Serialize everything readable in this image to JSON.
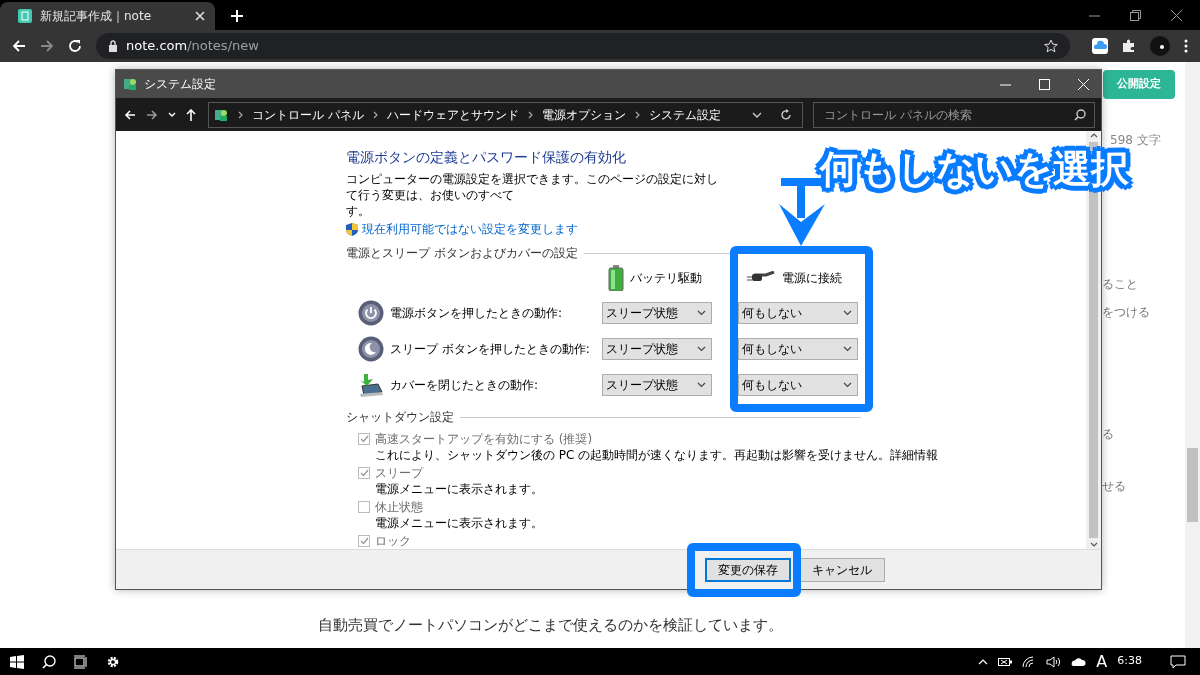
{
  "browser": {
    "tab_title": "新規記事作成｜note",
    "url_host": "note.com",
    "url_path": "/notes/new"
  },
  "note_page": {
    "publish_button": "公開設定",
    "char_count": "598 文字",
    "fragments": [
      "ること",
      "をつける",
      "る",
      "せる"
    ],
    "caption": "自動売買でノートパソコンがどこまで使えるのかを検証しています。"
  },
  "dialog": {
    "title": "システム設定",
    "breadcrumb": [
      "コントロール パネル",
      "ハードウェアとサウンド",
      "電源オプション",
      "システム設定"
    ],
    "search": {
      "placeholder": "コントロール パネルの検索"
    },
    "heading": "電源ボタンの定義とパスワード保護の有効化",
    "description": [
      "コンピューターの電源設定を選択できます。このページの設定に対して行う変更は、お使いのすべて",
      "す。"
    ],
    "admin_link": "現在利用可能ではない設定を変更します",
    "power_section": "電源とスリープ ボタンおよびカバーの設定",
    "columns": [
      {
        "label": "バッテリ駆動",
        "kind": "battery"
      },
      {
        "label": "電源に接続",
        "kind": "plug"
      }
    ],
    "rows": [
      {
        "kind": "power",
        "label": "電源ボタンを押したときの動作:",
        "values": [
          "スリープ状態",
          "何もしない"
        ]
      },
      {
        "kind": "sleep",
        "label": "スリープ ボタンを押したときの動作:",
        "values": [
          "スリープ状態",
          "何もしない"
        ]
      },
      {
        "kind": "lid",
        "label": "カバーを閉じたときの動作:",
        "values": [
          "スリープ状態",
          "何もしない"
        ]
      }
    ],
    "shutdown_section": "シャットダウン設定",
    "shutdown_options": [
      {
        "label": "高速スタートアップを有効にする (推奨)",
        "checked": true,
        "description": "これにより、シャットダウン後の PC の起動時間が速くなります。再起動は影響を受けません。",
        "link": "詳細情報"
      },
      {
        "label": "スリープ",
        "checked": true,
        "description": "電源メニューに表示されます。"
      },
      {
        "label": "休止状態",
        "checked": false,
        "description": "電源メニューに表示されます。"
      },
      {
        "label": "ロック",
        "checked": true
      }
    ],
    "buttons": [
      {
        "label": "変更の保存",
        "kind": "primary"
      },
      {
        "label": "キャンセル",
        "kind": "secondary"
      }
    ]
  },
  "annotation": {
    "callout": "何もしないを選択"
  },
  "taskbar": {
    "ime": "A",
    "time": "6:38"
  }
}
